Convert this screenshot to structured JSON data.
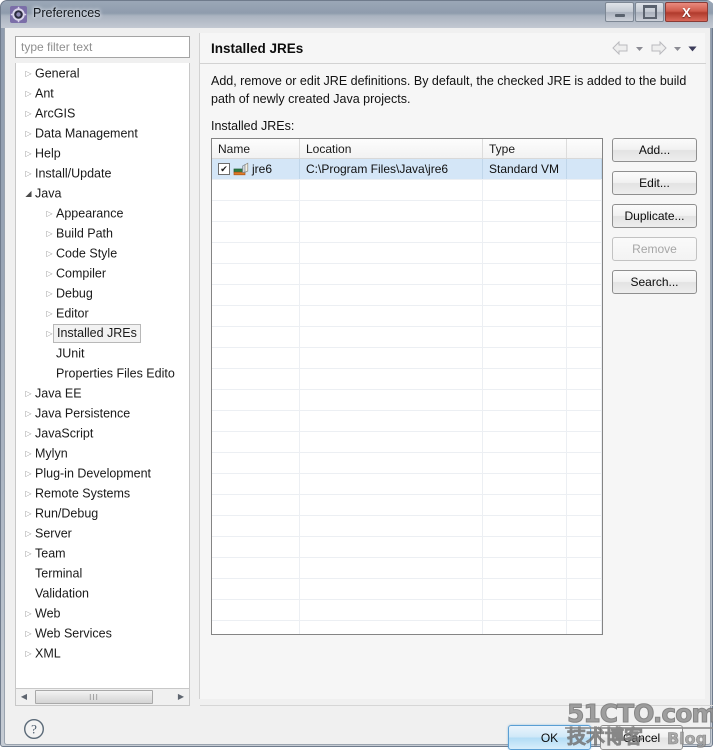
{
  "window": {
    "title": "Preferences",
    "icon": "preferences-gear-icon",
    "controls": {
      "minimize": "–",
      "maximize": "□",
      "close": "X"
    }
  },
  "sidebar": {
    "filter": {
      "placeholder": "type filter text",
      "value": ""
    },
    "items": [
      {
        "label": "General",
        "depth": 0,
        "arrow": "collapsed",
        "selected": false
      },
      {
        "label": "Ant",
        "depth": 0,
        "arrow": "collapsed",
        "selected": false
      },
      {
        "label": "ArcGIS",
        "depth": 0,
        "arrow": "collapsed",
        "selected": false
      },
      {
        "label": "Data Management",
        "depth": 0,
        "arrow": "collapsed",
        "selected": false
      },
      {
        "label": "Help",
        "depth": 0,
        "arrow": "collapsed",
        "selected": false
      },
      {
        "label": "Install/Update",
        "depth": 0,
        "arrow": "collapsed",
        "selected": false
      },
      {
        "label": "Java",
        "depth": 0,
        "arrow": "expanded",
        "selected": false
      },
      {
        "label": "Appearance",
        "depth": 1,
        "arrow": "collapsed",
        "selected": false
      },
      {
        "label": "Build Path",
        "depth": 1,
        "arrow": "collapsed",
        "selected": false
      },
      {
        "label": "Code Style",
        "depth": 1,
        "arrow": "collapsed",
        "selected": false
      },
      {
        "label": "Compiler",
        "depth": 1,
        "arrow": "collapsed",
        "selected": false
      },
      {
        "label": "Debug",
        "depth": 1,
        "arrow": "collapsed",
        "selected": false
      },
      {
        "label": "Editor",
        "depth": 1,
        "arrow": "collapsed",
        "selected": false
      },
      {
        "label": "Installed JREs",
        "depth": 1,
        "arrow": "collapsed",
        "selected": true
      },
      {
        "label": "JUnit",
        "depth": 1,
        "arrow": "none",
        "selected": false
      },
      {
        "label": "Properties Files Edito",
        "depth": 1,
        "arrow": "none",
        "selected": false
      },
      {
        "label": "Java EE",
        "depth": 0,
        "arrow": "collapsed",
        "selected": false
      },
      {
        "label": "Java Persistence",
        "depth": 0,
        "arrow": "collapsed",
        "selected": false
      },
      {
        "label": "JavaScript",
        "depth": 0,
        "arrow": "collapsed",
        "selected": false
      },
      {
        "label": "Mylyn",
        "depth": 0,
        "arrow": "collapsed",
        "selected": false
      },
      {
        "label": "Plug-in Development",
        "depth": 0,
        "arrow": "collapsed",
        "selected": false
      },
      {
        "label": "Remote Systems",
        "depth": 0,
        "arrow": "collapsed",
        "selected": false
      },
      {
        "label": "Run/Debug",
        "depth": 0,
        "arrow": "collapsed",
        "selected": false
      },
      {
        "label": "Server",
        "depth": 0,
        "arrow": "collapsed",
        "selected": false
      },
      {
        "label": "Team",
        "depth": 0,
        "arrow": "collapsed",
        "selected": false
      },
      {
        "label": "Terminal",
        "depth": 0,
        "arrow": "none",
        "selected": false
      },
      {
        "label": "Validation",
        "depth": 0,
        "arrow": "none",
        "selected": false
      },
      {
        "label": "Web",
        "depth": 0,
        "arrow": "collapsed",
        "selected": false
      },
      {
        "label": "Web Services",
        "depth": 0,
        "arrow": "collapsed",
        "selected": false
      },
      {
        "label": "XML",
        "depth": 0,
        "arrow": "collapsed",
        "selected": false
      }
    ],
    "scrollbar": {
      "left_arrow": "◀",
      "right_arrow": "▶",
      "grip": "III"
    }
  },
  "page": {
    "title": "Installed JREs",
    "description": "Add, remove or edit JRE definitions. By default, the checked JRE is added to the build path of newly created Java projects.",
    "list_label": "Installed JREs:",
    "nav": {
      "back_icon": "arrow-left-icon",
      "back_menu_icon": "chevron-down-icon",
      "forward_icon": "arrow-right-icon",
      "forward_menu_icon": "chevron-down-icon",
      "menu_icon": "chevron-down-icon"
    }
  },
  "table": {
    "columns": [
      "Name",
      "Location",
      "Type",
      ""
    ],
    "rows": [
      {
        "checked": true,
        "check_glyph": "✔",
        "icon": "jre-library-icon",
        "name": "jre6",
        "location": "C:\\Program Files\\Java\\jre6",
        "type": "Standard VM",
        "extra": "",
        "selected": true
      }
    ],
    "empty_row_count": 22
  },
  "side_buttons": [
    {
      "label": "Add...",
      "enabled": true
    },
    {
      "label": "Edit...",
      "enabled": true
    },
    {
      "label": "Duplicate...",
      "enabled": true
    },
    {
      "label": "Remove",
      "enabled": false
    },
    {
      "label": "Search...",
      "enabled": true
    }
  ],
  "footer": {
    "help_icon": "help-question-icon",
    "ok_label": "OK",
    "cancel_label": "Cancel"
  },
  "watermark": {
    "top": "51CTO.com",
    "bottom": "技术博客",
    "blog": "Blog"
  },
  "colors": {
    "selection_blue": "#d4e6f7",
    "ok_accent": "#5a9fd4",
    "close_red": "#cf5a4b"
  }
}
